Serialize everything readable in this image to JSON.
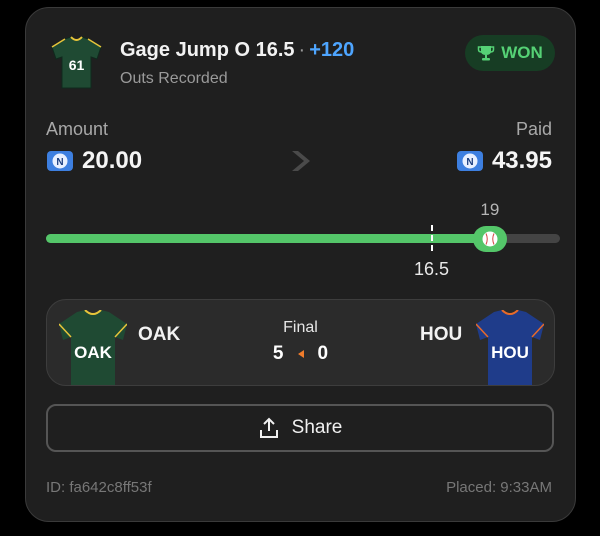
{
  "bet": {
    "player_jersey_number": "61",
    "title": "Gage Jump O 16.5",
    "separator": "·",
    "odds": "+120",
    "subtitle": "Outs Recorded",
    "status": "WON",
    "status_icon": "trophy-icon"
  },
  "amounts": {
    "amount_label": "Amount",
    "amount_value": "20.00",
    "paid_label": "Paid",
    "paid_value": "43.95",
    "currency_icon": "coin-icon",
    "arrow_icon": "chevron-right-icon"
  },
  "progress": {
    "result_value": "19",
    "line_value": "16.5",
    "scale_max": 22,
    "thumb_icon": "baseball-icon"
  },
  "game": {
    "away_abbr": "OAK",
    "home_abbr": "HOU",
    "status": "Final",
    "away_score": "5",
    "home_score": "0"
  },
  "actions": {
    "share_label": "Share",
    "share_icon": "share-icon"
  },
  "footer": {
    "id_text": "ID: fa642c8ff53f",
    "placed_text": "Placed: 9:33AM"
  },
  "colors": {
    "accent_green": "#54c669",
    "odds_blue": "#4ea5ff",
    "won_badge_bg": "#173d24",
    "oak_jersey": "#1f4a33",
    "hou_jersey": "#1f3c8a"
  }
}
